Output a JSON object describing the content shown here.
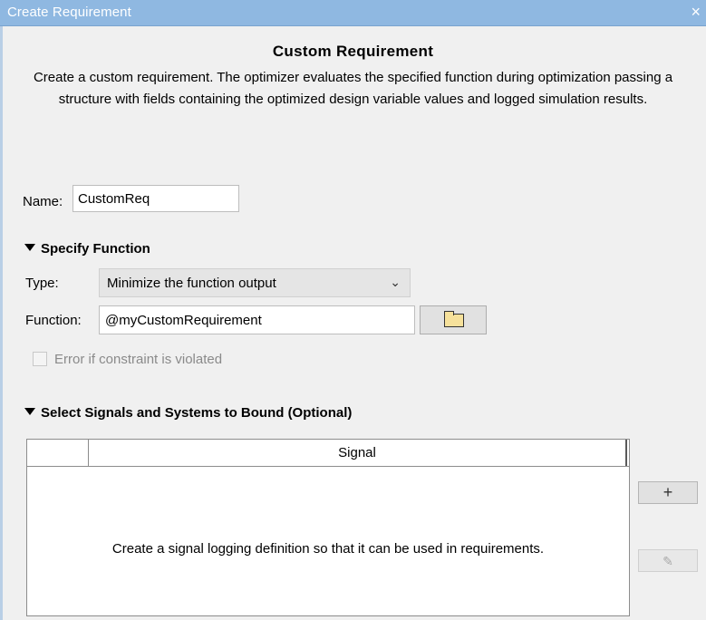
{
  "window": {
    "title": "Create Requirement",
    "close_glyph": "×"
  },
  "header": {
    "heading": "Custom Requirement",
    "description": "Create a custom requirement. The optimizer evaluates the specified function during optimization passing a structure with fields containing the optimized design variable values and logged simulation results."
  },
  "name": {
    "label": "Name:",
    "value": "CustomReq"
  },
  "specify_function": {
    "title": "Specify Function",
    "type_label": "Type:",
    "type_value": "Minimize the function output",
    "function_label": "Function:",
    "function_value": "@myCustomRequirement",
    "browse_icon": "folder-icon",
    "checkbox_label": "Error if constraint is violated",
    "checkbox_checked": false,
    "checkbox_enabled": false
  },
  "signals": {
    "title": "Select Signals and Systems to Bound (Optional)",
    "columns": [
      "",
      "Signal"
    ],
    "empty_message": "Create a signal logging definition so that it can be used in requirements.",
    "add_glyph": "+",
    "edit_glyph": "✎",
    "add_icon": "plus-icon",
    "edit_icon": "pencil-icon"
  },
  "colors": {
    "titlebar": "#8fb8e1",
    "background": "#f0f0f0",
    "disabled_text": "#8a8a8a"
  }
}
